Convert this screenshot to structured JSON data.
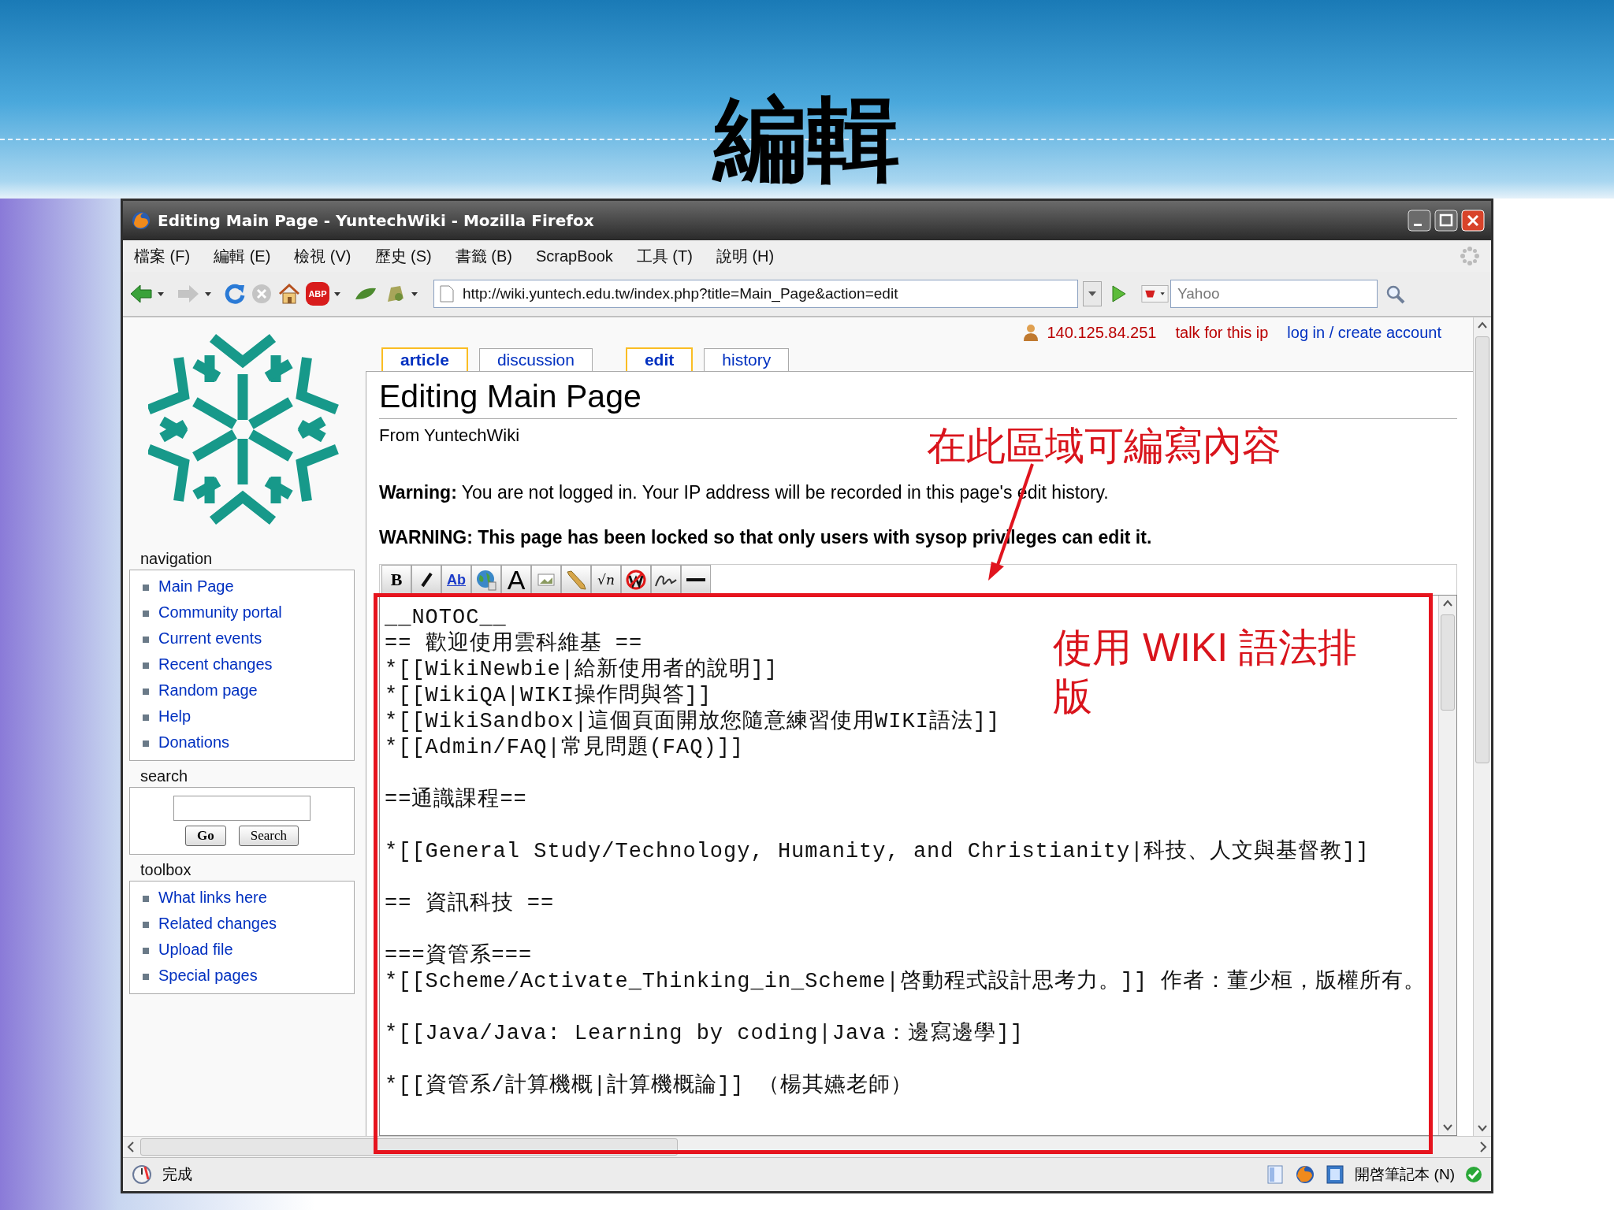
{
  "slide": {
    "title": "編輯"
  },
  "window": {
    "title": "Editing Main Page - YuntechWiki - Mozilla Firefox"
  },
  "menu": [
    "檔案 (F)",
    "編輯 (E)",
    "檢視 (V)",
    "歷史 (S)",
    "書籤 (B)",
    "ScrapBook",
    "工具 (T)",
    "說明 (H)"
  ],
  "nav_buttons": [
    {
      "kind": "back",
      "disabled": false
    },
    {
      "kind": "forward",
      "disabled": true
    },
    {
      "kind": "reload",
      "disabled": false
    },
    {
      "kind": "stop",
      "disabled": true
    },
    {
      "kind": "home",
      "disabled": false
    },
    {
      "kind": "adblock",
      "glyph": "ABP",
      "disabled": false
    },
    {
      "kind": "leaf",
      "disabled": false
    },
    {
      "kind": "scrapbook",
      "disabled": false
    }
  ],
  "address_bar": {
    "value": "http://wiki.yuntech.edu.tw/index.php?title=Main_Page&action=edit"
  },
  "search_box": {
    "placeholder": "Yahoo"
  },
  "personal_links": [
    {
      "kind": "user",
      "text": "140.125.84.251"
    },
    {
      "kind": "new",
      "text": "talk for this ip"
    },
    {
      "kind": "link",
      "text": "log in / create account"
    }
  ],
  "sidebar": {
    "portlets": [
      {
        "kind": "links",
        "title": "navigation",
        "items": [
          "Main Page",
          "Community portal",
          "Current events",
          "Recent changes",
          "Random page",
          "Help",
          "Donations"
        ]
      },
      {
        "kind": "search",
        "title": "search",
        "buttons": [
          "Go",
          "Search"
        ]
      },
      {
        "kind": "links",
        "title": "toolbox",
        "items": [
          "What links here",
          "Related changes",
          "Upload file",
          "Special pages"
        ]
      }
    ]
  },
  "tabs": [
    {
      "label": "article",
      "selected": true
    },
    {
      "label": "discussion",
      "selected": false
    },
    {
      "label": "edit",
      "selected": true
    },
    {
      "label": "history",
      "selected": false
    }
  ],
  "heading": "Editing Main Page",
  "subtitle": "From YuntechWiki",
  "warning": "**Warning:** You are not logged in. Your IP address will be recorded in this page's edit history.",
  "lock_warning": "WARNING: This page has been locked so that only users with sysop privileges can edit it.",
  "edit_toolbar": [
    {
      "kind": "bold",
      "glyph": "B"
    },
    {
      "kind": "italic"
    },
    {
      "kind": "link",
      "glyph": "Ab"
    },
    {
      "kind": "globe"
    },
    {
      "kind": "headline",
      "glyph": "A"
    },
    {
      "kind": "image"
    },
    {
      "kind": "media"
    },
    {
      "kind": "math",
      "glyph": "√n"
    },
    {
      "kind": "nowiki"
    },
    {
      "kind": "signature"
    },
    {
      "kind": "rule"
    }
  ],
  "editor": {
    "paragraphs": [
      [
        "__NOTOC__",
        "== 歡迎使用雲科維基 ==",
        "*[[WikiNewbie|給新使用者的說明]]",
        "*[[WikiQA|WIKI操作問與答]]",
        "*[[WikiSandbox|這個頁面開放您隨意練習使用WIKI語法]]",
        "*[[Admin/FAQ|常見問題(FAQ)]]"
      ],
      [
        "==通識課程=="
      ],
      [
        "*[[General Study/Technology, Humanity, and Christianity|科技、人文與基督教]]"
      ],
      [
        "== 資訊科技 =="
      ],
      [
        "===資管系===",
        "*[[Scheme/Activate_Thinking_in_Scheme|啓動程式設計思考力。]] 作者：董少桓，版權所有。"
      ],
      [
        "*[[Java/Java: Learning by coding|Java：邊寫邊學]]"
      ],
      [
        "*[[資管系/計算機概|計算機概論]] （楊其嬿老師）"
      ]
    ]
  },
  "annotations": [
    {
      "kind": "arrow",
      "text": "在此區域可編寫內容"
    },
    {
      "kind": "box",
      "text": "使用 WIKI 語法排版"
    }
  ],
  "status_bar": {
    "text": "完成",
    "notebook": "開啓筆記本 (N)"
  }
}
